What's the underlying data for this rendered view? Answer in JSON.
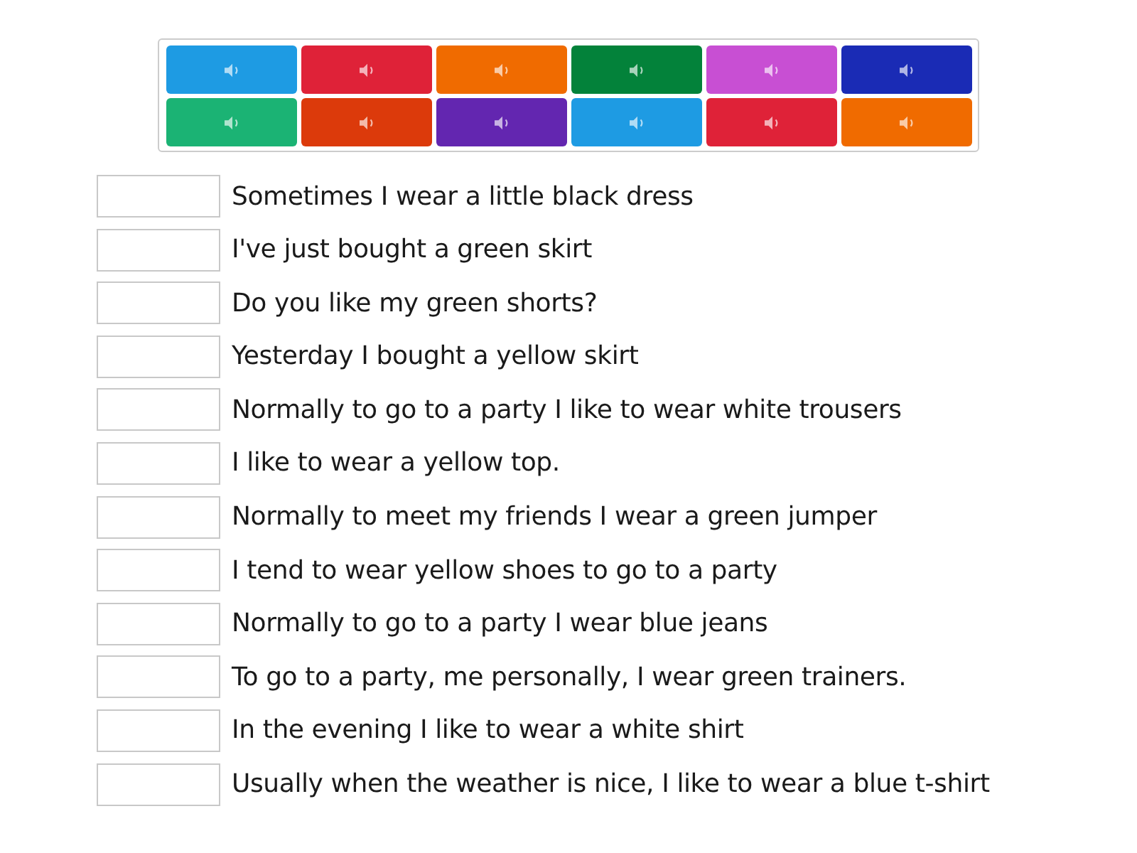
{
  "tiles": [
    {
      "color": "#1e9be3"
    },
    {
      "color": "#df2238"
    },
    {
      "color": "#f06b00"
    },
    {
      "color": "#03823a"
    },
    {
      "color": "#c84fd3"
    },
    {
      "color": "#1a2bb5"
    },
    {
      "color": "#1bb374"
    },
    {
      "color": "#dc3a0b"
    },
    {
      "color": "#6326b0"
    },
    {
      "color": "#1e9be3"
    },
    {
      "color": "#df2238"
    },
    {
      "color": "#f06b00"
    }
  ],
  "items": [
    {
      "text": "Sometimes I wear a little black dress"
    },
    {
      "text": "I've just bought a green skirt"
    },
    {
      "text": "Do you like my green shorts?"
    },
    {
      "text": "Yesterday I bought a yellow skirt"
    },
    {
      "text": "Normally to go to a party I like to wear white trousers"
    },
    {
      "text": "I like to wear a yellow top."
    },
    {
      "text": "Normally to meet my friends I wear a green jumper"
    },
    {
      "text": "I tend to wear yellow shoes to go to a party"
    },
    {
      "text": "Normally to go to a party I wear blue jeans"
    },
    {
      "text": "To go to a party, me personally, I wear green trainers."
    },
    {
      "text": "In the evening I like to wear a white shirt"
    },
    {
      "text": "Usually when the weather is nice, I like to wear a blue t-shirt"
    }
  ]
}
